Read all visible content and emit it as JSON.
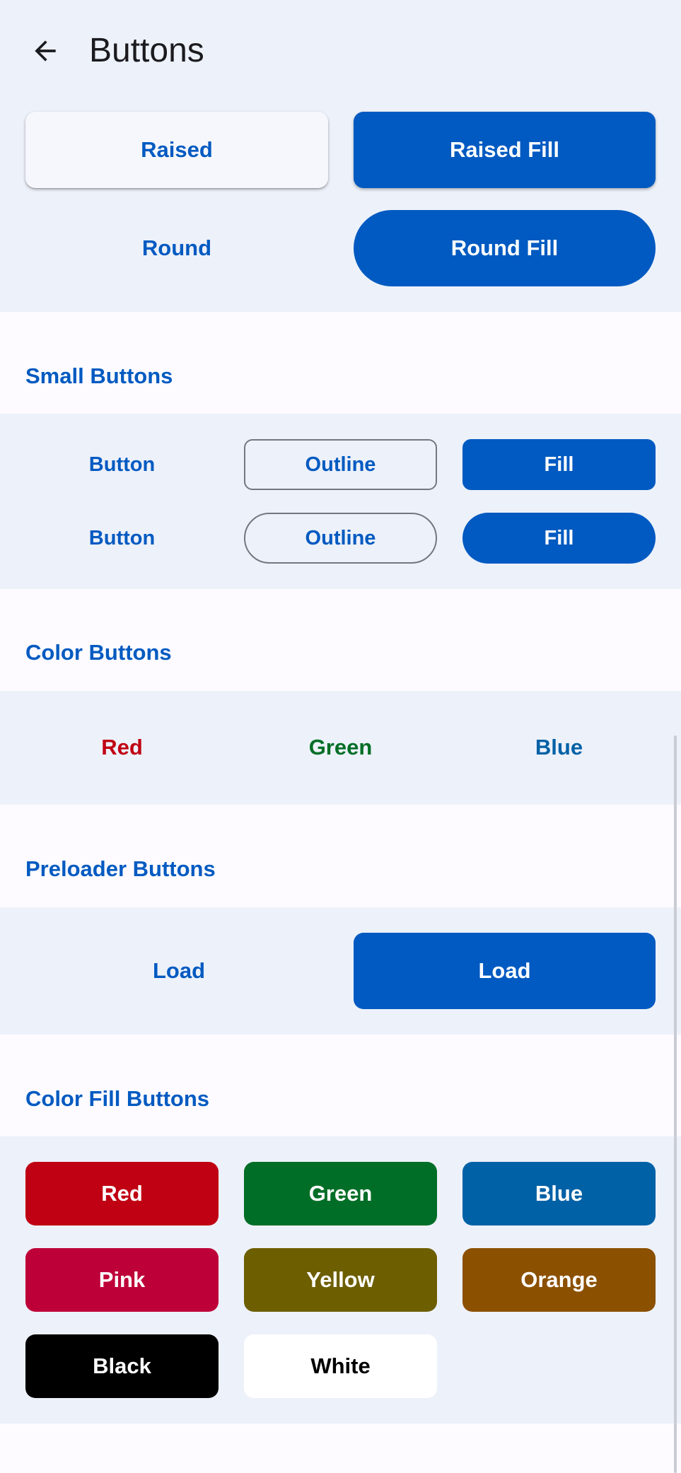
{
  "navbar": {
    "title": "Buttons",
    "back_icon": "arrow-left-icon"
  },
  "top_block": {
    "raised": "Raised",
    "raised_fill": "Raised Fill",
    "round": "Round",
    "round_fill": "Round Fill"
  },
  "small_buttons": {
    "title": "Small Buttons",
    "row1": [
      "Button",
      "Outline",
      "Fill"
    ],
    "row2": [
      "Button",
      "Outline",
      "Fill"
    ]
  },
  "color_buttons": {
    "title": "Color Buttons",
    "items": [
      {
        "label": "Red",
        "color": "#c00013"
      },
      {
        "label": "Green",
        "color": "#006e26"
      },
      {
        "label": "Blue",
        "color": "#0061a6"
      }
    ]
  },
  "preloader_buttons": {
    "title": "Preloader Buttons",
    "load": "Load",
    "load_fill": "Load"
  },
  "color_fill_buttons": {
    "title": "Color Fill Buttons",
    "items": [
      {
        "label": "Red",
        "bg": "#c00013",
        "fg": "#ffffff"
      },
      {
        "label": "Green",
        "bg": "#006e26",
        "fg": "#ffffff"
      },
      {
        "label": "Blue",
        "bg": "#0061a6",
        "fg": "#ffffff"
      },
      {
        "label": "Pink",
        "bg": "#be0039",
        "fg": "#ffffff"
      },
      {
        "label": "Yellow",
        "bg": "#6d5e00",
        "fg": "#ffffff"
      },
      {
        "label": "Orange",
        "bg": "#8b5000",
        "fg": "#ffffff"
      },
      {
        "label": "Black",
        "bg": "#000000",
        "fg": "#ffffff"
      },
      {
        "label": "White",
        "bg": "#ffffff",
        "fg": "#000000"
      }
    ]
  }
}
